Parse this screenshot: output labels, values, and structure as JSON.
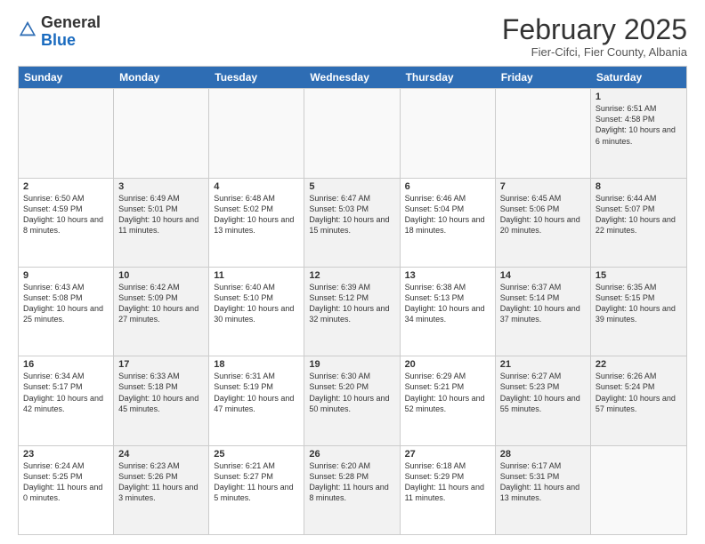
{
  "header": {
    "logo_general": "General",
    "logo_blue": "Blue",
    "month_title": "February 2025",
    "subtitle": "Fier-Cifci, Fier County, Albania"
  },
  "weekdays": [
    "Sunday",
    "Monday",
    "Tuesday",
    "Wednesday",
    "Thursday",
    "Friday",
    "Saturday"
  ],
  "rows": [
    [
      {
        "num": "",
        "info": "",
        "empty": true
      },
      {
        "num": "",
        "info": "",
        "empty": true
      },
      {
        "num": "",
        "info": "",
        "empty": true
      },
      {
        "num": "",
        "info": "",
        "empty": true
      },
      {
        "num": "",
        "info": "",
        "empty": true
      },
      {
        "num": "",
        "info": "",
        "empty": true
      },
      {
        "num": "1",
        "info": "Sunrise: 6:51 AM\nSunset: 4:58 PM\nDaylight: 10 hours and 6 minutes.",
        "shaded": true
      }
    ],
    [
      {
        "num": "2",
        "info": "Sunrise: 6:50 AM\nSunset: 4:59 PM\nDaylight: 10 hours and 8 minutes."
      },
      {
        "num": "3",
        "info": "Sunrise: 6:49 AM\nSunset: 5:01 PM\nDaylight: 10 hours and 11 minutes.",
        "shaded": true
      },
      {
        "num": "4",
        "info": "Sunrise: 6:48 AM\nSunset: 5:02 PM\nDaylight: 10 hours and 13 minutes."
      },
      {
        "num": "5",
        "info": "Sunrise: 6:47 AM\nSunset: 5:03 PM\nDaylight: 10 hours and 15 minutes.",
        "shaded": true
      },
      {
        "num": "6",
        "info": "Sunrise: 6:46 AM\nSunset: 5:04 PM\nDaylight: 10 hours and 18 minutes."
      },
      {
        "num": "7",
        "info": "Sunrise: 6:45 AM\nSunset: 5:06 PM\nDaylight: 10 hours and 20 minutes.",
        "shaded": true
      },
      {
        "num": "8",
        "info": "Sunrise: 6:44 AM\nSunset: 5:07 PM\nDaylight: 10 hours and 22 minutes.",
        "shaded": true
      }
    ],
    [
      {
        "num": "9",
        "info": "Sunrise: 6:43 AM\nSunset: 5:08 PM\nDaylight: 10 hours and 25 minutes."
      },
      {
        "num": "10",
        "info": "Sunrise: 6:42 AM\nSunset: 5:09 PM\nDaylight: 10 hours and 27 minutes.",
        "shaded": true
      },
      {
        "num": "11",
        "info": "Sunrise: 6:40 AM\nSunset: 5:10 PM\nDaylight: 10 hours and 30 minutes."
      },
      {
        "num": "12",
        "info": "Sunrise: 6:39 AM\nSunset: 5:12 PM\nDaylight: 10 hours and 32 minutes.",
        "shaded": true
      },
      {
        "num": "13",
        "info": "Sunrise: 6:38 AM\nSunset: 5:13 PM\nDaylight: 10 hours and 34 minutes."
      },
      {
        "num": "14",
        "info": "Sunrise: 6:37 AM\nSunset: 5:14 PM\nDaylight: 10 hours and 37 minutes.",
        "shaded": true
      },
      {
        "num": "15",
        "info": "Sunrise: 6:35 AM\nSunset: 5:15 PM\nDaylight: 10 hours and 39 minutes.",
        "shaded": true
      }
    ],
    [
      {
        "num": "16",
        "info": "Sunrise: 6:34 AM\nSunset: 5:17 PM\nDaylight: 10 hours and 42 minutes."
      },
      {
        "num": "17",
        "info": "Sunrise: 6:33 AM\nSunset: 5:18 PM\nDaylight: 10 hours and 45 minutes.",
        "shaded": true
      },
      {
        "num": "18",
        "info": "Sunrise: 6:31 AM\nSunset: 5:19 PM\nDaylight: 10 hours and 47 minutes."
      },
      {
        "num": "19",
        "info": "Sunrise: 6:30 AM\nSunset: 5:20 PM\nDaylight: 10 hours and 50 minutes.",
        "shaded": true
      },
      {
        "num": "20",
        "info": "Sunrise: 6:29 AM\nSunset: 5:21 PM\nDaylight: 10 hours and 52 minutes."
      },
      {
        "num": "21",
        "info": "Sunrise: 6:27 AM\nSunset: 5:23 PM\nDaylight: 10 hours and 55 minutes.",
        "shaded": true
      },
      {
        "num": "22",
        "info": "Sunrise: 6:26 AM\nSunset: 5:24 PM\nDaylight: 10 hours and 57 minutes.",
        "shaded": true
      }
    ],
    [
      {
        "num": "23",
        "info": "Sunrise: 6:24 AM\nSunset: 5:25 PM\nDaylight: 11 hours and 0 minutes."
      },
      {
        "num": "24",
        "info": "Sunrise: 6:23 AM\nSunset: 5:26 PM\nDaylight: 11 hours and 3 minutes.",
        "shaded": true
      },
      {
        "num": "25",
        "info": "Sunrise: 6:21 AM\nSunset: 5:27 PM\nDaylight: 11 hours and 5 minutes."
      },
      {
        "num": "26",
        "info": "Sunrise: 6:20 AM\nSunset: 5:28 PM\nDaylight: 11 hours and 8 minutes.",
        "shaded": true
      },
      {
        "num": "27",
        "info": "Sunrise: 6:18 AM\nSunset: 5:29 PM\nDaylight: 11 hours and 11 minutes."
      },
      {
        "num": "28",
        "info": "Sunrise: 6:17 AM\nSunset: 5:31 PM\nDaylight: 11 hours and 13 minutes.",
        "shaded": true
      },
      {
        "num": "",
        "info": "",
        "empty": true
      }
    ]
  ]
}
